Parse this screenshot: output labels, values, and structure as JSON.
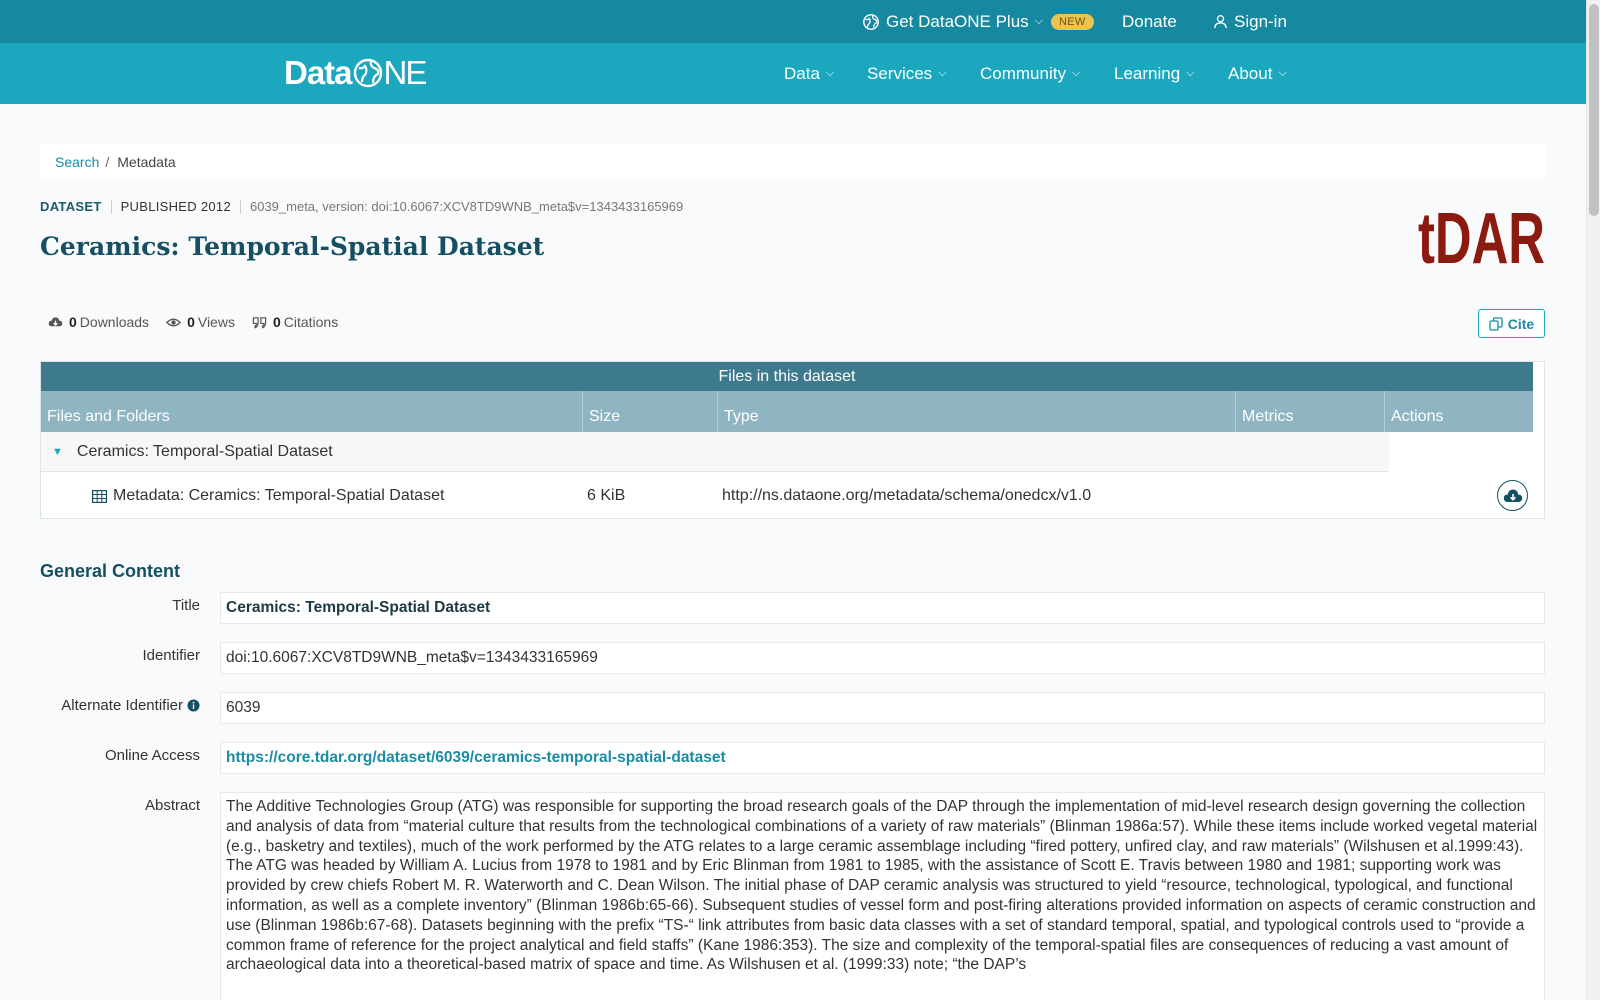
{
  "topbar": {
    "plus_label": "Get DataONE Plus",
    "new_badge": "NEW",
    "donate": "Donate",
    "signin": "Sign-in"
  },
  "navbar": {
    "logo_text_a": "Data",
    "logo_text_b": "NE",
    "items": [
      "Data",
      "Services",
      "Community",
      "Learning",
      "About"
    ]
  },
  "breadcrumb": {
    "search": "Search",
    "separator": "/",
    "current": "Metadata"
  },
  "header": {
    "type": "DATASET",
    "published": "PUBLISHED 2012",
    "version": "6039_meta, version: doi:10.6067:XCV8TD9WNB_meta$v=1343433165969",
    "title": "Ceramics: Temporal-Spatial Dataset",
    "repo_logo_text": "tDAR"
  },
  "stats": {
    "downloads_count": "0",
    "downloads_label": "Downloads",
    "views_count": "0",
    "views_label": "Views",
    "citations_count": "0",
    "citations_label": "Citations",
    "cite_button": "Cite"
  },
  "files": {
    "heading": "Files in this dataset",
    "columns": [
      "Files and Folders",
      "Size",
      "Type",
      "Metrics",
      "Actions"
    ],
    "folder": "Ceramics: Temporal-Spatial Dataset",
    "file": {
      "name": "Metadata: Ceramics: Temporal-Spatial Dataset",
      "size": "6 KiB",
      "type": "http://ns.dataone.org/metadata/schema/onedcx/v1.0"
    }
  },
  "general": {
    "heading": "General Content",
    "title_label": "Title",
    "title_value": "Ceramics: Temporal-Spatial Dataset",
    "identifier_label": "Identifier",
    "identifier_value": "doi:10.6067:XCV8TD9WNB_meta$v=1343433165969",
    "alt_identifier_label": "Alternate Identifier",
    "alt_identifier_value": "6039",
    "online_access_label": "Online Access",
    "online_access_value": "https://core.tdar.org/dataset/6039/ceramics-temporal-spatial-dataset",
    "abstract_label": "Abstract",
    "abstract_value": "The Additive Technologies Group (ATG) was responsible for supporting the broad research goals of the DAP through the implementation of mid-level research design governing the collection and analysis of data from “material culture that results from the technological combinations of a variety of raw materials” (Blinman 1986a:57). While these items include worked vegetal material (e.g., basketry and textiles), much of the work performed by the ATG relates to a large ceramic assemblage including “fired pottery, unfired clay, and raw materials” (Wilshusen et al.1999:43). The ATG was headed by William A. Lucius from 1978 to 1981 and by Eric Blinman from 1981 to 1985, with the assistance of Scott E. Travis between 1980 and 1981; supporting work was provided by crew chiefs Robert M. R. Waterworth and C. Dean Wilson. The initial phase of DAP ceramic analysis was structured to yield “resource, technological, typological, and functional information, as well as a complete inventory” (Blinman 1986b:65-66). Subsequent studies of vessel form and post-firing alterations provided information on aspects of ceramic construction and use (Blinman 1986b:67-68). Datasets beginning with the prefix “TS-“ link attributes from basic data classes with a set of standard temporal, spatial, and typological controls used to “provide a common frame of reference for the project analytical and field staffs” (Kane 1986:353). The size and complexity of the temporal-spatial files are consequences of reducing a vast amount of archaeological data into a theoretical-based matrix of space and time. As Wilshusen et al. (1999:33) note; “the DAP’s"
  },
  "colors": {
    "topbar": "#16889f",
    "navbar": "#1ba7bd",
    "files_header": "#3e7a8d",
    "files_columns": "#8fb4c2",
    "title": "#154f62",
    "tdar_logo": "#8b1a10",
    "new_badge": "#e9c451"
  }
}
